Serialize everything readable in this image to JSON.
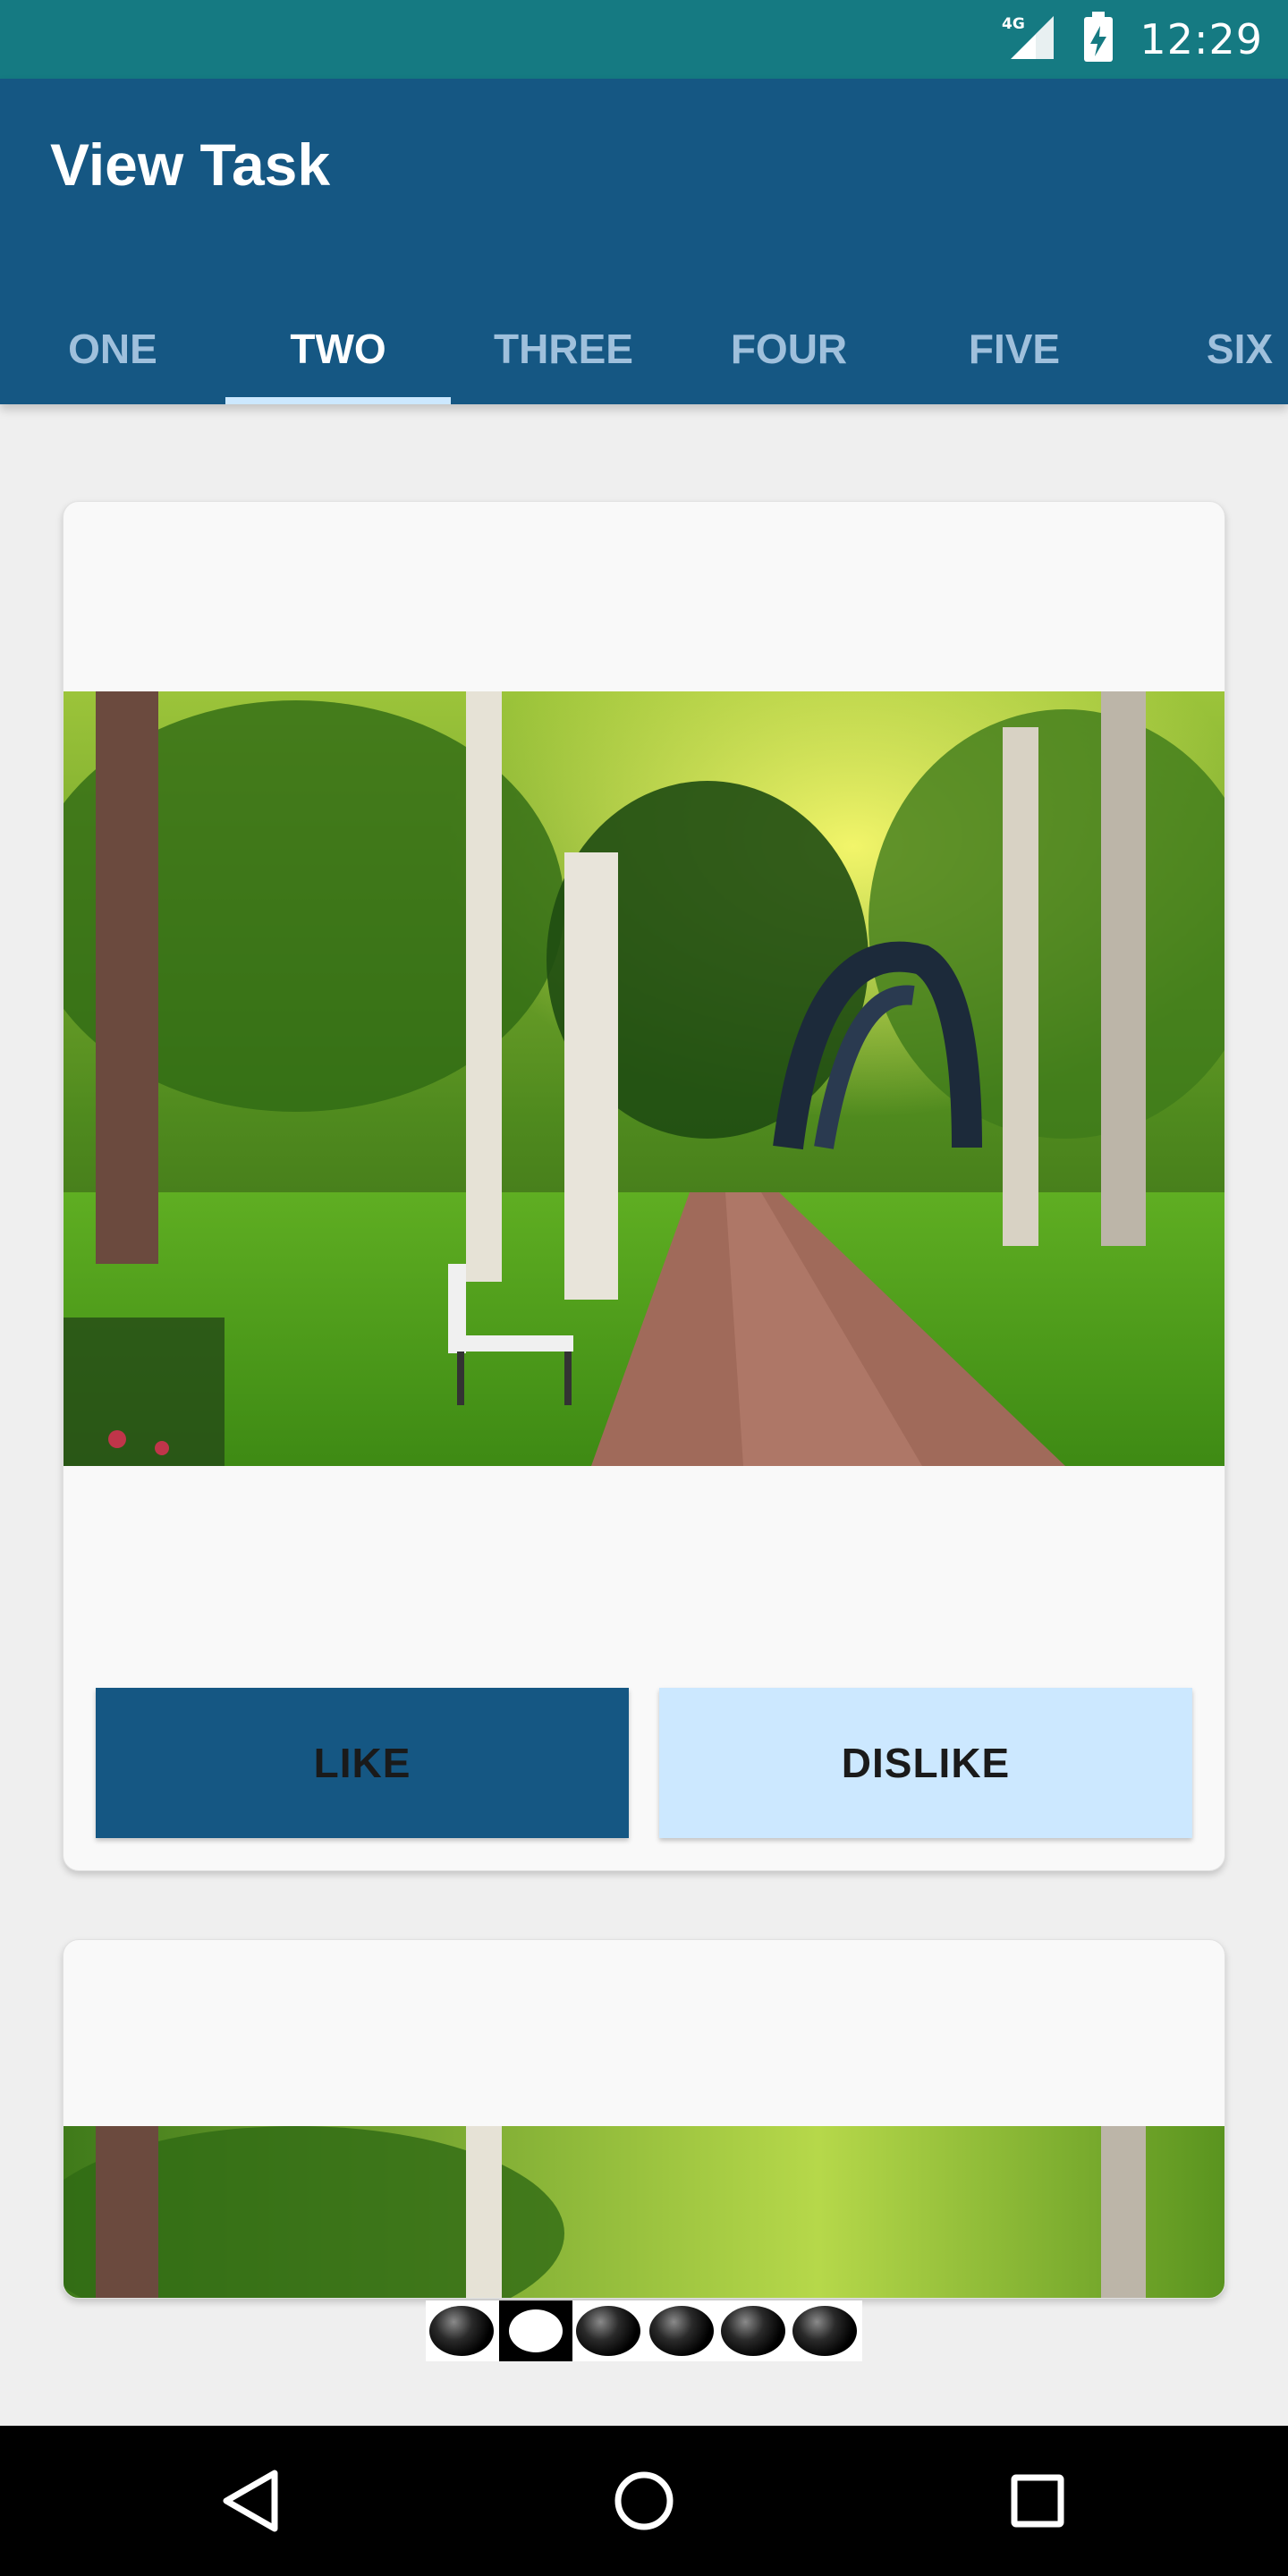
{
  "status_bar": {
    "network": "4G",
    "time": "12:29"
  },
  "app_bar": {
    "title": "View Task"
  },
  "tabs": [
    {
      "label": "ONE",
      "active": false
    },
    {
      "label": "TWO",
      "active": true
    },
    {
      "label": "THREE",
      "active": false
    },
    {
      "label": "FOUR",
      "active": false
    },
    {
      "label": "FIVE",
      "active": false
    },
    {
      "label": "SIX",
      "active": false
    }
  ],
  "cards": [
    {
      "image": "park-path-with-bench-image",
      "like_label": "LIKE",
      "dislike_label": "DISLIKE"
    },
    {
      "image": "park-path-with-bench-image"
    }
  ],
  "pager": {
    "count": 6,
    "active_index": 1
  },
  "nav": {
    "icons": [
      "back-icon",
      "home-icon",
      "recents-icon"
    ]
  },
  "colors": {
    "status_bar": "#157a82",
    "primary": "#155783",
    "accent_light": "#cce8ff",
    "background": "#efefef"
  }
}
